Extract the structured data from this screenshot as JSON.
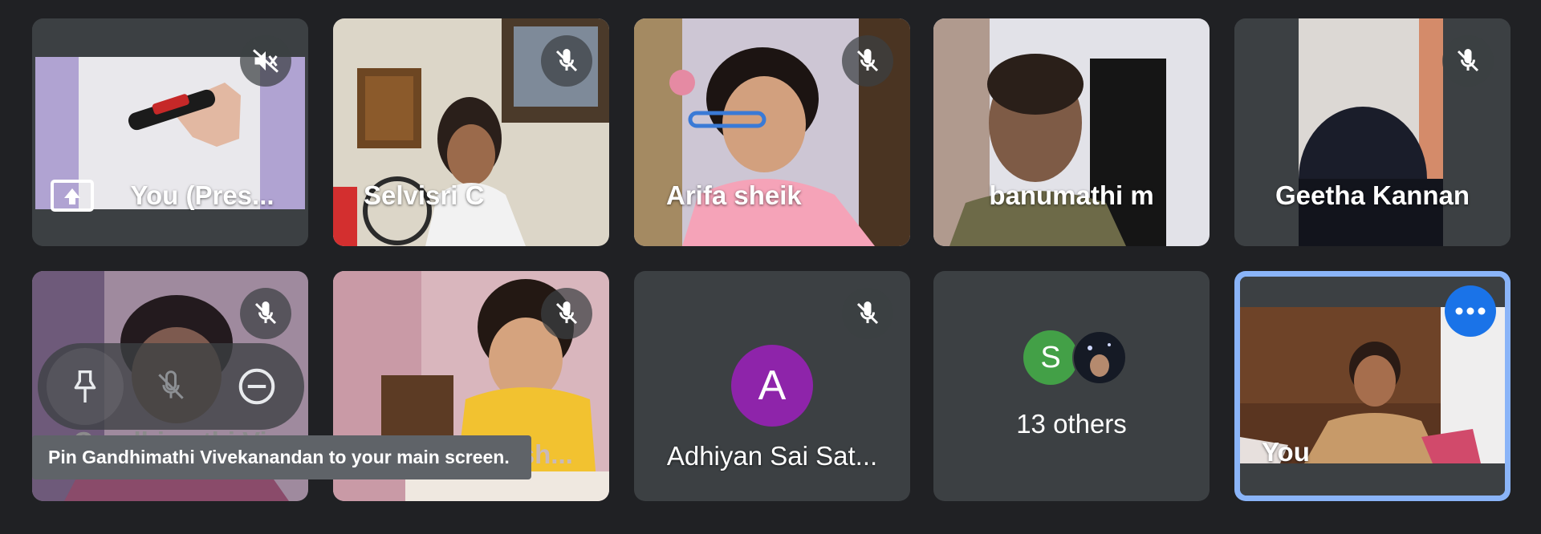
{
  "colors": {
    "background": "#202124",
    "tile": "#3c4043",
    "self_border": "#8ab4f8",
    "more_button": "#1a73e8",
    "avatar_a": "#8e24aa",
    "avatar_s": "#43a047"
  },
  "tiles": [
    {
      "name": "You (Pres...",
      "mic": "muted"
    },
    {
      "name": "Selvisri C",
      "mic": "muted"
    },
    {
      "name": "Arifa sheik",
      "mic": "muted"
    },
    {
      "name": "banumathi m"
    },
    {
      "name": "Geetha Kannan",
      "mic": "muted"
    },
    {
      "name": "Gandhimathi Vi",
      "mic": "muted"
    },
    {
      "name": "Mouktitha Ash...",
      "mic": "muted"
    },
    {
      "name": "Adhiyan Sai Sat...",
      "avatar_letter": "A",
      "mic": "muted"
    },
    {
      "name": "13 others",
      "avatar_letter": "S"
    },
    {
      "name": "You"
    }
  ],
  "hover_controls": {
    "pin_icon": "pin-icon",
    "mute_icon": "mic-off-icon",
    "remove_icon": "remove-icon"
  },
  "tooltip": "Pin Gandhimathi Vivekanandan to your main screen."
}
